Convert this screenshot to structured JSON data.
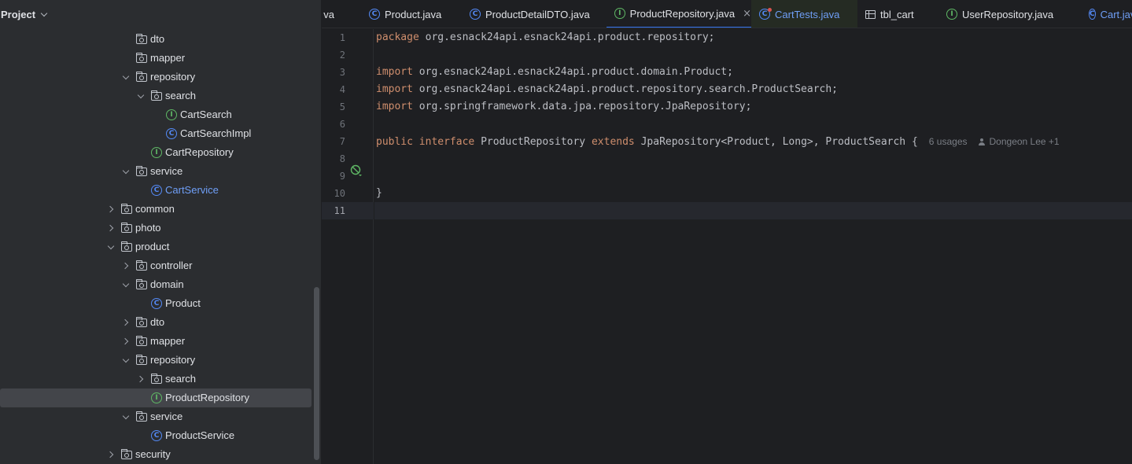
{
  "project_panel": {
    "title": "Project"
  },
  "tree": [
    {
      "label": "dto",
      "type": "folder",
      "arrow": "none",
      "indent": 0
    },
    {
      "label": "mapper",
      "type": "folder",
      "arrow": "none",
      "indent": 0
    },
    {
      "label": "repository",
      "type": "folder",
      "arrow": "expanded",
      "indent": 0
    },
    {
      "label": "search",
      "type": "folder",
      "arrow": "expanded",
      "indent": 1
    },
    {
      "label": "CartSearch",
      "type": "interface",
      "arrow": "none",
      "indent": 2
    },
    {
      "label": "CartSearchImpl",
      "type": "class",
      "arrow": "none",
      "indent": 2
    },
    {
      "label": "CartRepository",
      "type": "interface",
      "arrow": "none",
      "indent": 1
    },
    {
      "label": "service",
      "type": "folder",
      "arrow": "expanded",
      "indent": 0
    },
    {
      "label": "CartService",
      "type": "class",
      "arrow": "none",
      "indent": 1,
      "color": "blue"
    },
    {
      "label": "common",
      "type": "folder",
      "arrow": "collapsed",
      "indent": -1
    },
    {
      "label": "photo",
      "type": "folder",
      "arrow": "collapsed",
      "indent": -1
    },
    {
      "label": "product",
      "type": "folder",
      "arrow": "expanded",
      "indent": -1
    },
    {
      "label": "controller",
      "type": "folder",
      "arrow": "collapsed",
      "indent": 0
    },
    {
      "label": "domain",
      "type": "folder",
      "arrow": "expanded",
      "indent": 0
    },
    {
      "label": "Product",
      "type": "class",
      "arrow": "none",
      "indent": 1
    },
    {
      "label": "dto",
      "type": "folder",
      "arrow": "collapsed",
      "indent": 0
    },
    {
      "label": "mapper",
      "type": "folder",
      "arrow": "collapsed",
      "indent": 0
    },
    {
      "label": "repository",
      "type": "folder",
      "arrow": "expanded",
      "indent": 0
    },
    {
      "label": "search",
      "type": "folder",
      "arrow": "collapsed",
      "indent": 1
    },
    {
      "label": "ProductRepository",
      "type": "interface",
      "arrow": "none",
      "indent": 1,
      "selected": true
    },
    {
      "label": "service",
      "type": "folder",
      "arrow": "expanded",
      "indent": 0
    },
    {
      "label": "ProductService",
      "type": "class",
      "arrow": "none",
      "indent": 1
    },
    {
      "label": "security",
      "type": "folder",
      "arrow": "collapsed",
      "indent": -1
    }
  ],
  "tabs": [
    {
      "label": "va",
      "icon": "none"
    },
    {
      "label": "Product.java",
      "icon": "class"
    },
    {
      "label": "ProductDetailDTO.java",
      "icon": "class"
    },
    {
      "label": "ProductRepository.java",
      "icon": "interface",
      "active": true,
      "close": "×"
    },
    {
      "label": "CartTests.java",
      "icon": "class-test",
      "modified": true,
      "color": "blue"
    },
    {
      "label": "tbl_cart",
      "icon": "table"
    },
    {
      "label": "UserRepository.java",
      "icon": "interface"
    },
    {
      "label": "Cart.java",
      "icon": "class",
      "color": "blue"
    }
  ],
  "editor": {
    "line_numbers": [
      "1",
      "2",
      "3",
      "4",
      "5",
      "6",
      "7",
      "8",
      "9",
      "10",
      "11"
    ],
    "current_line": "11",
    "lines": [
      [
        {
          "t": "package",
          "k": "kw"
        },
        {
          "t": " org.esnack24api.esnack24api.product.repository;",
          "k": "plain"
        }
      ],
      [],
      [
        {
          "t": "import",
          "k": "kw"
        },
        {
          "t": " org.esnack24api.esnack24api.product.domain.Product;",
          "k": "plain"
        }
      ],
      [
        {
          "t": "import",
          "k": "kw"
        },
        {
          "t": " org.esnack24api.esnack24api.product.repository.search.ProductSearch;",
          "k": "plain"
        }
      ],
      [
        {
          "t": "import",
          "k": "kw"
        },
        {
          "t": " org.springframework.data.jpa.repository.JpaRepository;",
          "k": "plain"
        }
      ],
      [],
      [
        {
          "t": "public",
          "k": "kw"
        },
        {
          "t": " ",
          "k": "plain"
        },
        {
          "t": "interface",
          "k": "kw"
        },
        {
          "t": " ProductRepository ",
          "k": "plain"
        },
        {
          "t": "extends",
          "k": "kw"
        },
        {
          "t": " JpaRepository<Product, Long>, ProductSearch {",
          "k": "plain"
        }
      ],
      [],
      [],
      [
        {
          "t": "}",
          "k": "plain"
        }
      ],
      []
    ],
    "usages_hint": "6 usages",
    "author_hint": "Dongeon Lee +1"
  },
  "colors": {
    "keyword": "#cf8e6d",
    "text": "#bcbec4",
    "interface_icon": "#5fb865",
    "class_icon": "#548af7",
    "accent": "#3574f0"
  }
}
